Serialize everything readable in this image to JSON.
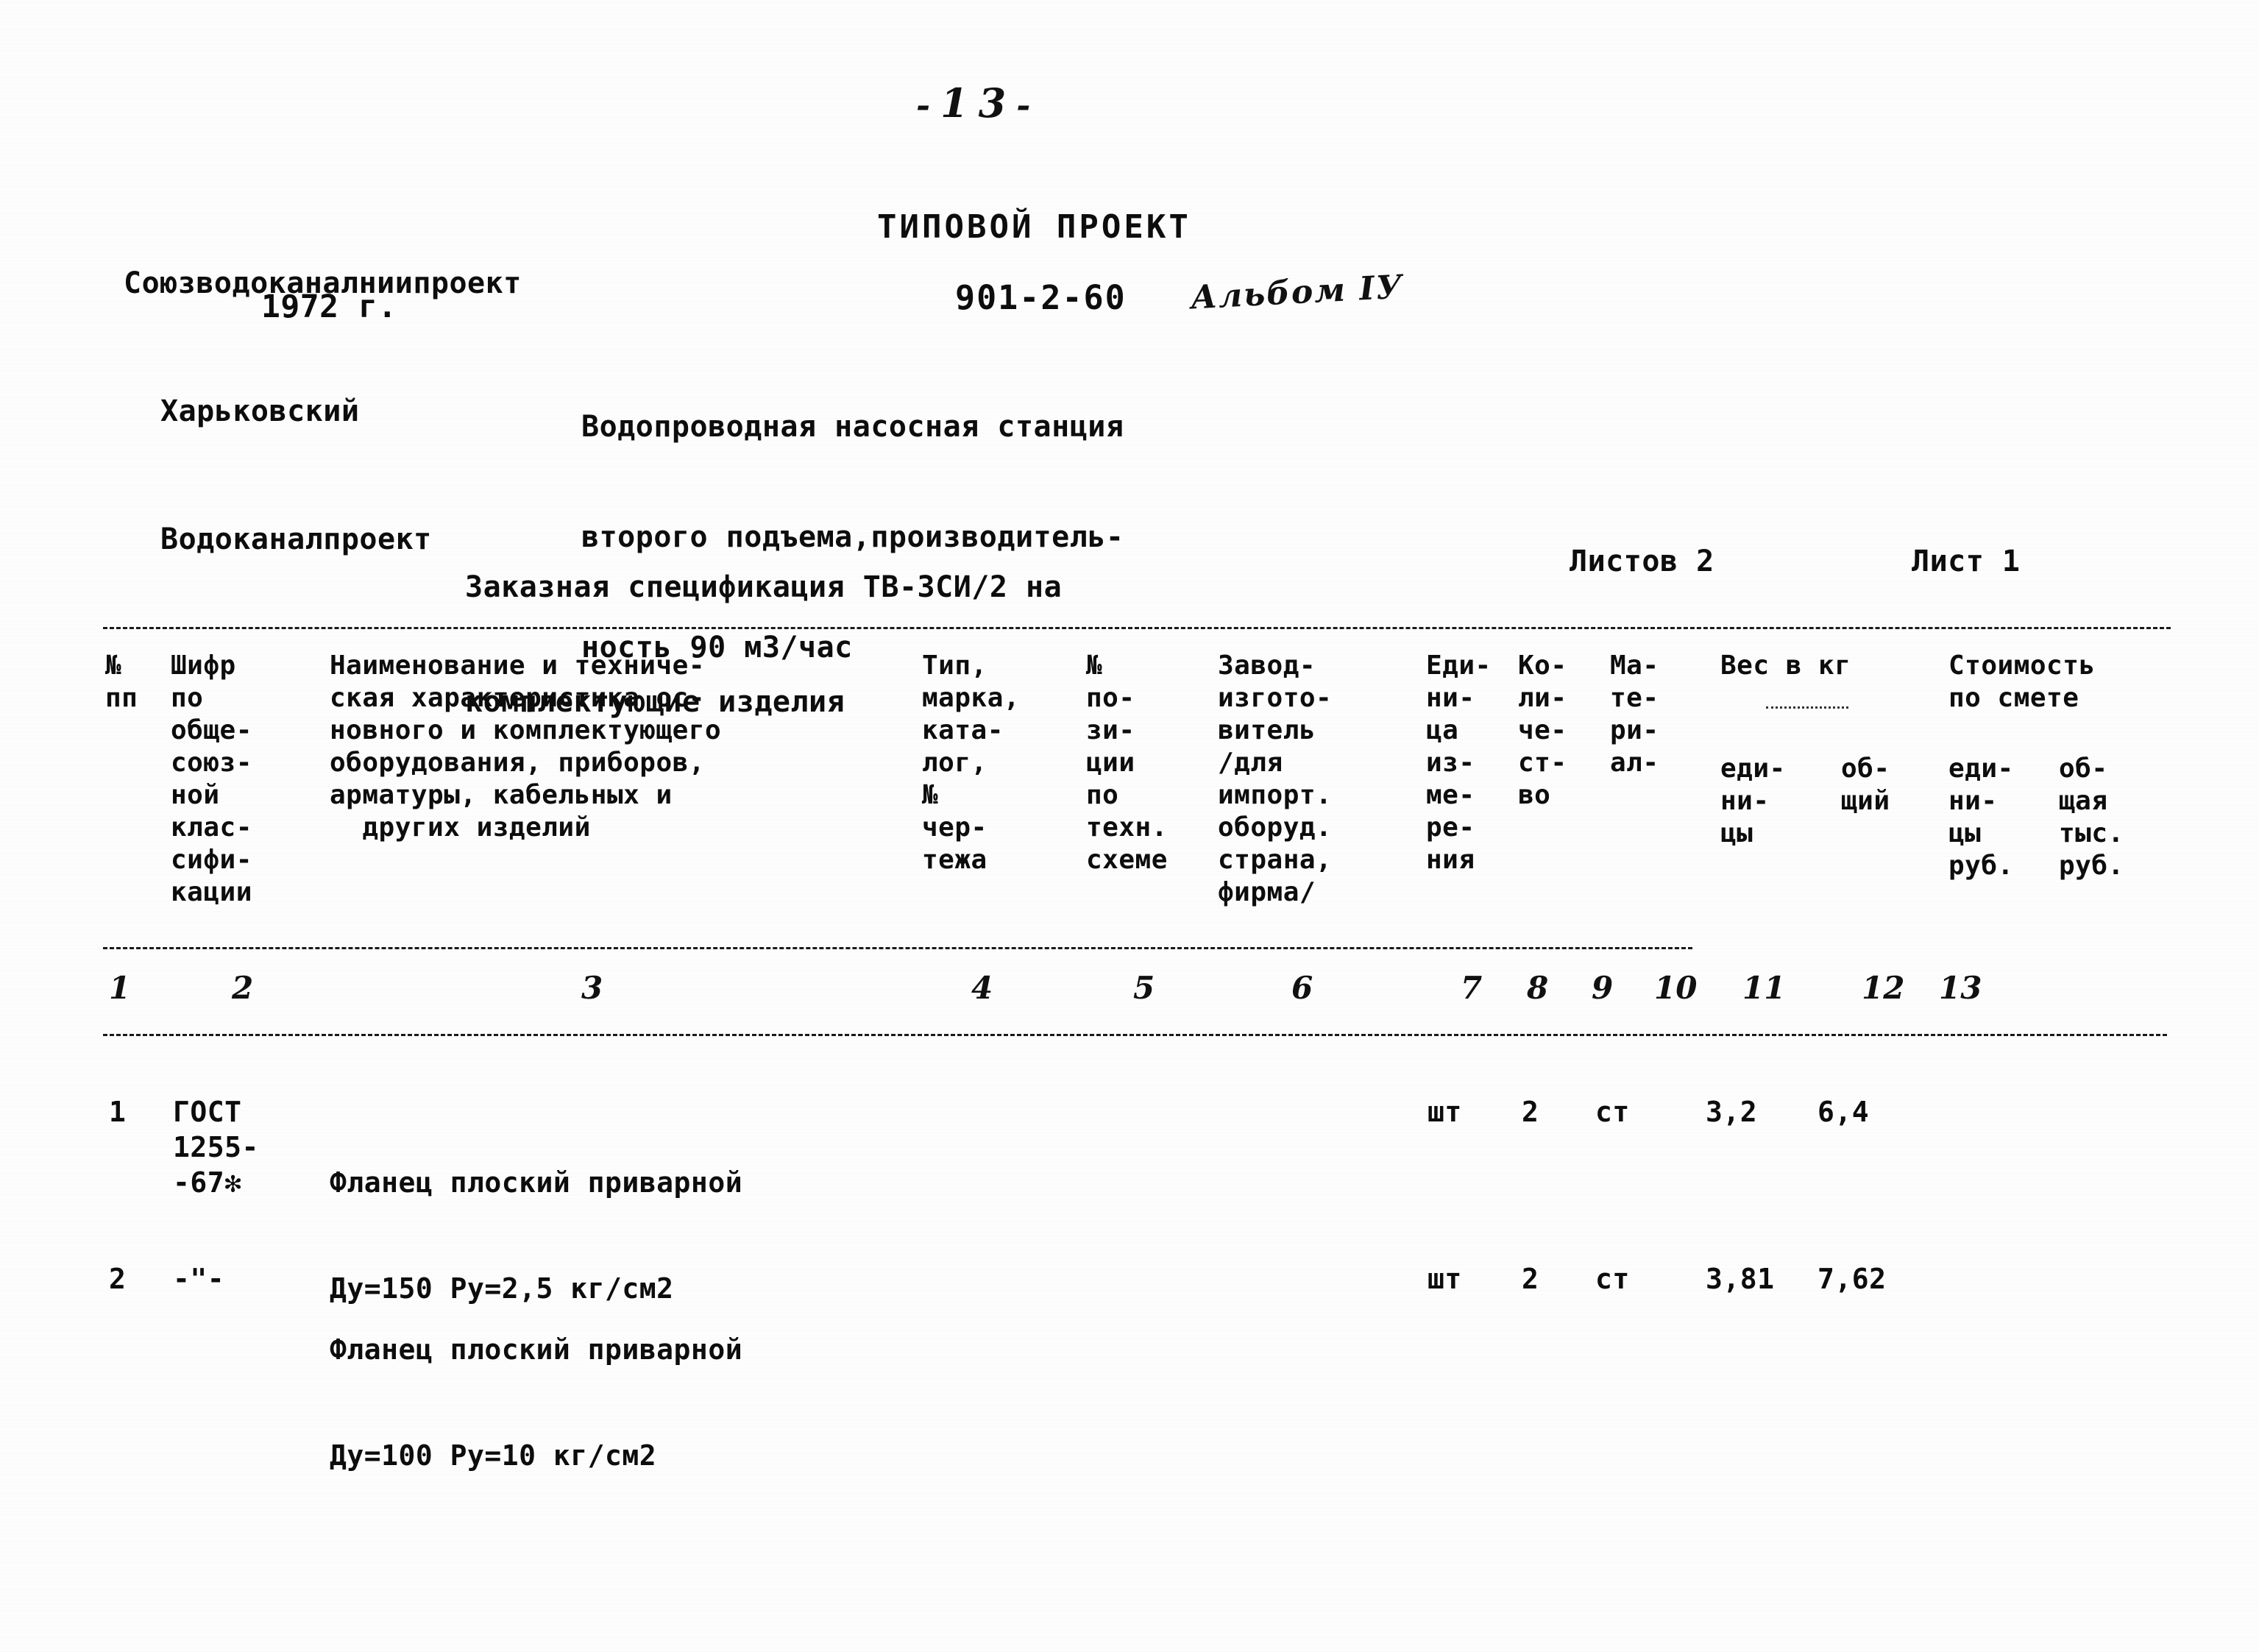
{
  "page": {
    "number_prefix": "-",
    "number": "13",
    "number_suffix": "-"
  },
  "org": {
    "line1": "Союзводоканалниипроект",
    "line2": "Харьковский",
    "line3": "Водоканалпроект",
    "year": "1972 г."
  },
  "title": {
    "project_type": "ТИПОВОЙ ПРОЕКТ",
    "project_code": "901-2-60",
    "album": "Альбом IУ",
    "desc_line1": "Водопроводная насосная станция",
    "desc_line2": "второго подъема,производитель-",
    "desc_line3": "ность 90 м3/час"
  },
  "spec": {
    "line1": "Заказная спецификация ТВ-ЗСИ/2 на",
    "line2": "комплектующие изделия",
    "sheets_total": "Листов 2",
    "sheet_current": "Лист 1"
  },
  "table": {
    "headers": {
      "c1": "№\nпп",
      "c2": "Шифр\nпо\nобще-\nсоюз-\nной\nклас-\nсифи-\nкации",
      "c3": "Наименование и техниче-\nская характеристика ос-\nновного и комплектующего\nоборудования, приборов,\nарматуры, кабельных и\n  других изделий",
      "c4": "Тип,\nмарка,\nката-\nлог,\n№\nчер-\nтежа",
      "c5": "№\nпо-\nзи-\nции\nпо\nтехн.\nсхеме",
      "c6": "Завод-\nизгото-\nвитель\n/для\nимпорт.\nоборуд.\nстрана,\nфирма/",
      "c7": "Еди-\nни-\nца\nиз-\nме-\nре-\nния",
      "c8": "Ко-\nли-\nче-\nст-\nво",
      "c9": "Ма-\nте-\nри-\nал-",
      "c10_group": "Вес в кг",
      "c10": "еди-\nни-\nцы",
      "c11": "об-\nщий",
      "c12_group": "Стоимость\nпо смете",
      "c12": "еди-\nни-\nцы\nруб.",
      "c13": "об-\nщая\nтыс.\nруб."
    },
    "column_numbers": [
      "1",
      "2",
      "3",
      "4",
      "5",
      "6",
      "7",
      "8",
      "9",
      "10",
      "11",
      "12",
      "13"
    ],
    "rows": [
      {
        "num": "1",
        "code": "ГОСТ\n1255-\n-67✻",
        "name_line1": "Фланец плоский приварной",
        "name_line2": "Ду=150 Ру=2,5 кг/см2",
        "type": "",
        "position": "",
        "manufacturer": "",
        "unit": "шт",
        "qty": "2",
        "material": "ст",
        "weight_unit": "3,2",
        "weight_total": "6,4",
        "cost_unit": "",
        "cost_total": ""
      },
      {
        "num": "2",
        "code": "-\"-",
        "name_line1": "Фланец плоский приварной",
        "name_line2": "Ду=100 Ру=10 кг/см2",
        "type": "",
        "position": "",
        "manufacturer": "",
        "unit": "шт",
        "qty": "2",
        "material": "ст",
        "weight_unit": "3,81",
        "weight_total": "7,62",
        "cost_unit": "",
        "cost_total": ""
      }
    ]
  },
  "colors": {
    "ink": "#0d0d0d",
    "paper": "#fdfdfd"
  }
}
